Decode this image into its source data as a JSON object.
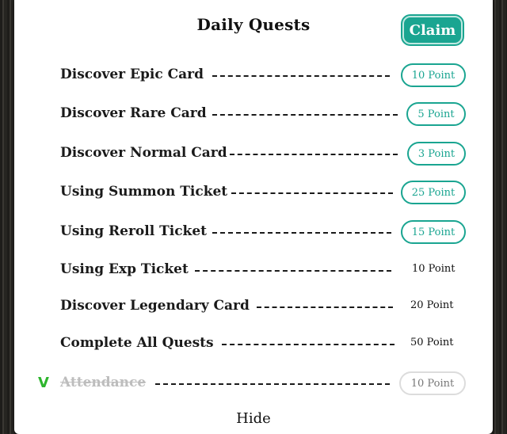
{
  "panel": {
    "title": "Daily Quests",
    "claim_label": "Claim",
    "hide_label": "Hide",
    "accent_color": "#1aa591",
    "check_color": "#2db52d"
  },
  "quests": [
    {
      "name": "Discover Epic Card",
      "points": "10 Point",
      "state": "claimable"
    },
    {
      "name": "Discover Rare Card",
      "points": "5 Point",
      "state": "claimable"
    },
    {
      "name": "Discover Normal Card",
      "points": "3 Point",
      "state": "claimable"
    },
    {
      "name": "Using Summon Ticket",
      "points": "25 Point",
      "state": "claimable"
    },
    {
      "name": "Using Reroll Ticket",
      "points": "15 Point",
      "state": "claimable"
    },
    {
      "name": "Using Exp Ticket",
      "points": "10 Point",
      "state": "incomplete"
    },
    {
      "name": "Discover Legendary Card",
      "points": "20 Point",
      "state": "incomplete"
    },
    {
      "name": "Complete All Quests",
      "points": "50 Point",
      "state": "incomplete"
    },
    {
      "name": "Attendance",
      "points": "10 Point",
      "state": "claimed",
      "check": "V"
    }
  ]
}
